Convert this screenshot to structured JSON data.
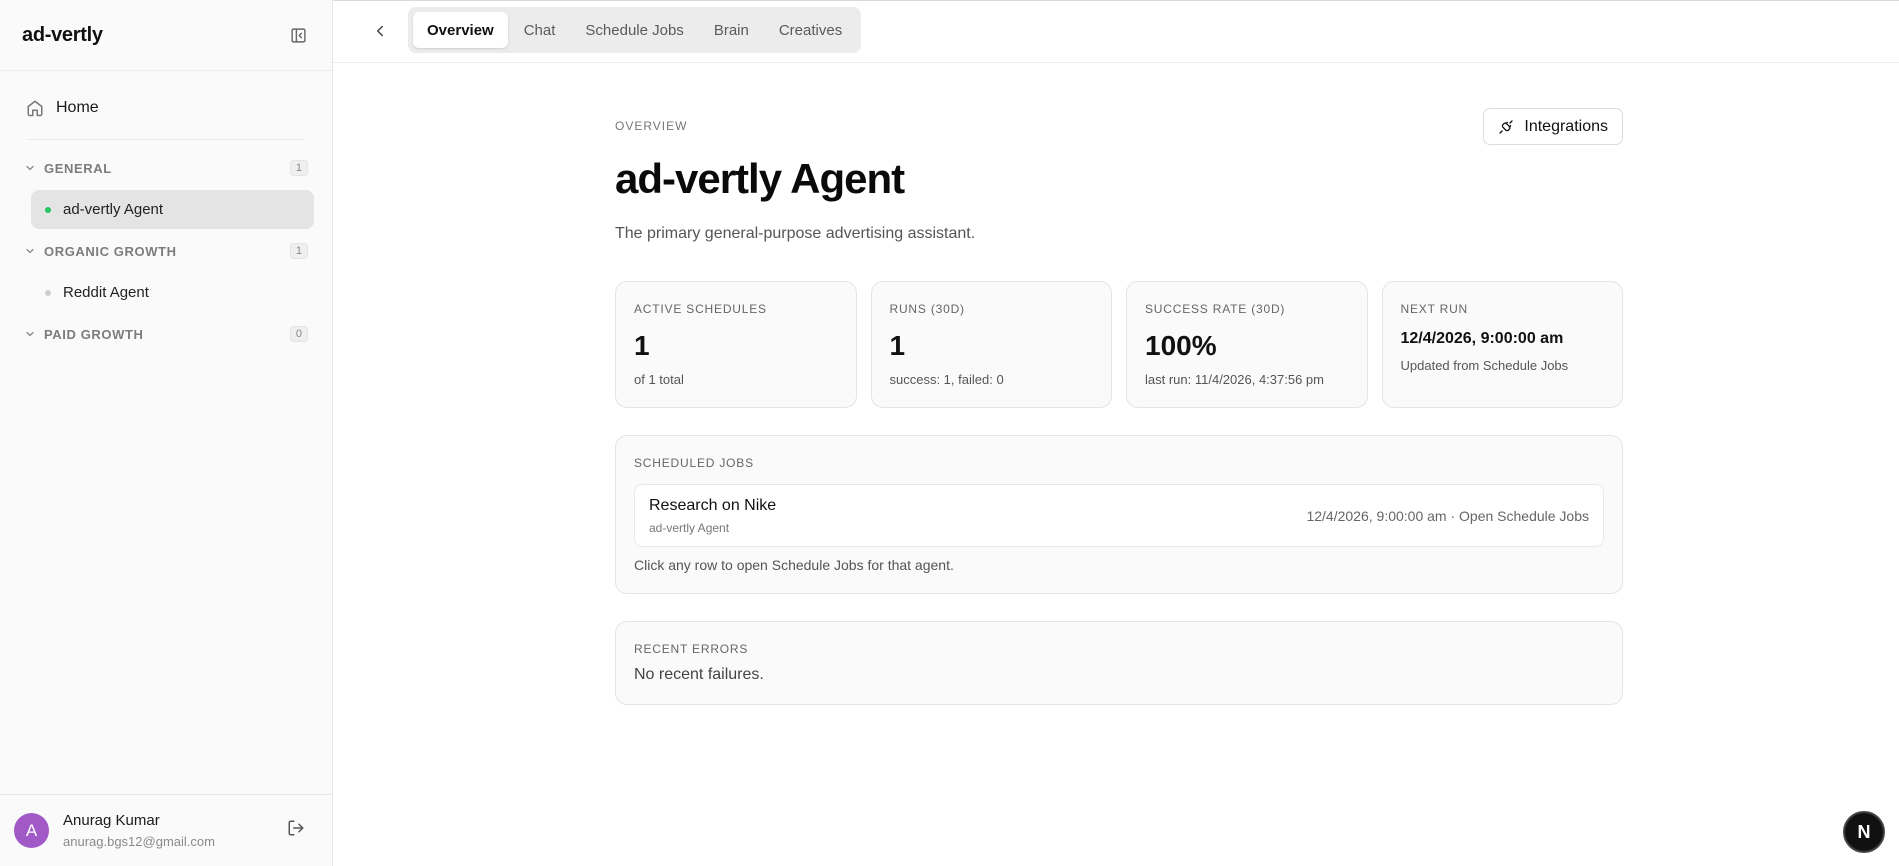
{
  "sidebar": {
    "brand": "ad-vertly",
    "home_label": "Home",
    "groups": [
      {
        "label": "GENERAL",
        "count": "1",
        "agents": [
          {
            "label": "ad-vertly Agent",
            "status_color": "#22c55e",
            "active": true
          }
        ]
      },
      {
        "label": "ORGANIC GROWTH",
        "count": "1",
        "agents": [
          {
            "label": "Reddit Agent",
            "status_color": "#cfcfcf",
            "active": false
          }
        ]
      },
      {
        "label": "PAID GROWTH",
        "count": "0",
        "agents": []
      }
    ],
    "user": {
      "initial": "A",
      "name": "Anurag Kumar",
      "email": "anurag.bgs12@gmail.com",
      "avatar_color": "#a259c8"
    }
  },
  "tabs": [
    {
      "label": "Overview",
      "active": true
    },
    {
      "label": "Chat",
      "active": false
    },
    {
      "label": "Schedule Jobs",
      "active": false
    },
    {
      "label": "Brain",
      "active": false
    },
    {
      "label": "Creatives",
      "active": false
    }
  ],
  "main": {
    "eyebrow": "OVERVIEW",
    "integrations_label": "Integrations",
    "title": "ad-vertly Agent",
    "subtitle": "The primary general-purpose advertising assistant.",
    "stats": [
      {
        "label": "ACTIVE SCHEDULES",
        "value": "1",
        "sub": "of 1 total"
      },
      {
        "label": "RUNS (30D)",
        "value": "1",
        "sub": "success: 1, failed: 0"
      },
      {
        "label": "SUCCESS RATE (30D)",
        "value": "100%",
        "sub": "last run: 11/4/2026, 4:37:56 pm"
      },
      {
        "label": "NEXT RUN",
        "value": "12/4/2026, 9:00:00 am",
        "sub": "Updated from Schedule Jobs"
      }
    ],
    "scheduled": {
      "label": "SCHEDULED JOBS",
      "jobs": [
        {
          "name": "Research on Nike",
          "agent": "ad-vertly Agent",
          "right": "12/4/2026, 9:00:00 am · Open Schedule Jobs"
        }
      ],
      "hint": "Click any row to open Schedule Jobs for that agent."
    },
    "errors": {
      "label": "RECENT ERRORS",
      "empty": "No recent failures."
    }
  },
  "fab": {
    "letter": "N"
  }
}
